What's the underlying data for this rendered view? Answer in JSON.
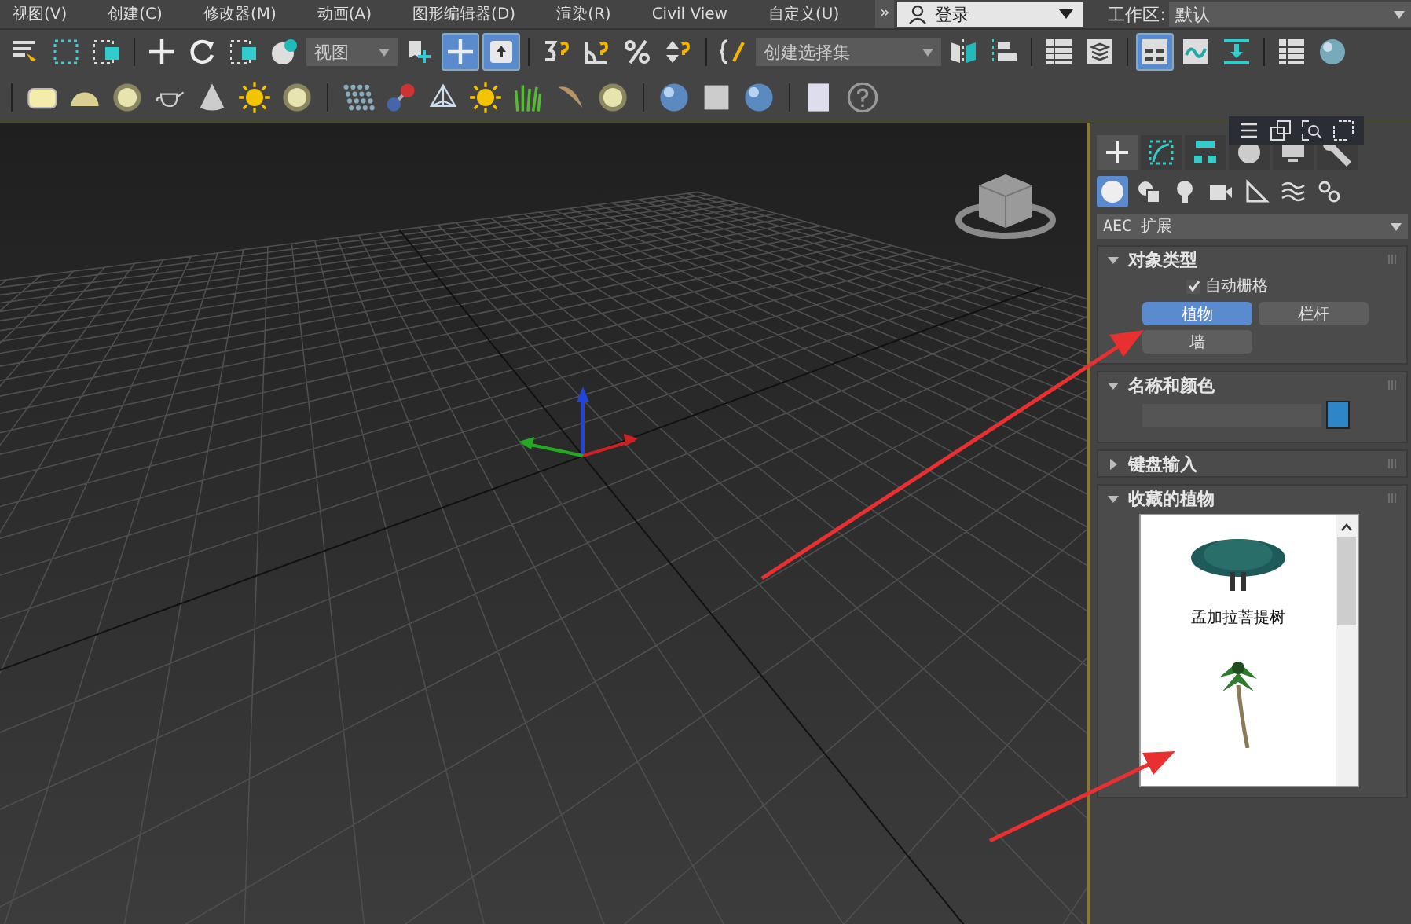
{
  "menu": [
    "视图(V)",
    "创建(C)",
    "修改器(M)",
    "动画(A)",
    "图形编辑器(D)",
    "渲染(R)",
    "Civil View",
    "自定义(U)"
  ],
  "overflow_button": "»",
  "login": {
    "label": "登录"
  },
  "workspace": {
    "label": "工作区:",
    "value": "默认"
  },
  "main_toolbar": {
    "view_dropdown": "视图",
    "selection_set_dropdown": "创建选择集",
    "buttons": [
      {
        "selected": false
      },
      {
        "selected": false
      },
      {
        "selected": false
      },
      {
        "selected": false
      },
      {
        "selected": false
      },
      {
        "selected": false
      },
      {
        "selected": false
      },
      {
        "selected": false
      },
      {
        "selected": true
      },
      {
        "selected": true
      },
      {
        "selected": false
      },
      {
        "selected": false
      },
      {
        "selected": false
      },
      {
        "selected": false
      },
      {
        "selected": false
      },
      {
        "selected": false
      },
      {
        "selected": false
      },
      {
        "selected": false
      },
      {
        "selected": false
      },
      {
        "selected": true
      },
      {
        "selected": false
      },
      {
        "selected": false
      },
      {
        "selected": false
      },
      {
        "selected": false
      }
    ]
  },
  "command_panel": {
    "tabs": [
      {
        "selected": true
      },
      {
        "selected": false
      },
      {
        "selected": false
      },
      {
        "selected": false
      },
      {
        "selected": false
      },
      {
        "selected": false
      }
    ],
    "categories": [
      {
        "selected": true
      },
      {
        "selected": false
      },
      {
        "selected": false
      },
      {
        "selected": false
      },
      {
        "selected": false
      },
      {
        "selected": false
      },
      {
        "selected": false
      }
    ],
    "dropdown": "AEC 扩展",
    "rollouts": [
      {
        "kind": "object_type",
        "title": "对象类型",
        "expanded": true,
        "auto_grid": {
          "label": "自动栅格",
          "checked": true
        },
        "buttons": [
          {
            "label": "植物",
            "selected": true
          },
          {
            "label": "栏杆",
            "selected": false
          },
          {
            "label": "墙",
            "selected": false
          }
        ]
      },
      {
        "kind": "name_color",
        "title": "名称和颜色",
        "expanded": true,
        "color": "#2e86c8"
      },
      {
        "title": "键盘输入",
        "expanded": false
      },
      {
        "kind": "plant_list",
        "title": "收藏的植物",
        "expanded": true,
        "plants": [
          {
            "kind": "broadleaf",
            "name": "孟加拉菩提树"
          },
          {
            "kind": "palm"
          }
        ]
      }
    ]
  }
}
